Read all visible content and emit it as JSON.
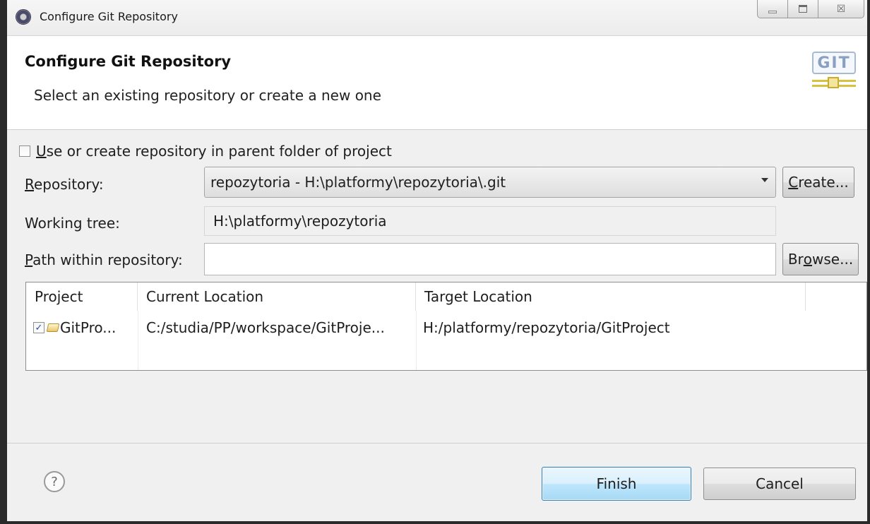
{
  "window": {
    "title": "Configure Git Repository",
    "controls": {
      "minimize_icon": "minimize-icon",
      "maximize_icon": "maximize-icon",
      "close_label": "☒"
    }
  },
  "banner": {
    "title": "Configure Git Repository",
    "subtitle": "Select an existing repository or create a new one",
    "logo_text": "GIT"
  },
  "form": {
    "parent_folder_checkbox": {
      "label_prefix": "U",
      "label_rest": "se or create repository in parent folder of project",
      "checked": false
    },
    "repository": {
      "label_prefix": "R",
      "label_rest": "epository:",
      "value": "repozytoria - H:\\platformy\\repozytoria\\.git"
    },
    "create_button": {
      "prefix": "C",
      "rest": "reate..."
    },
    "working_tree": {
      "label": "Working tree:",
      "value": "H:\\platformy\\repozytoria"
    },
    "path_within_repository": {
      "label_prefix": "P",
      "label_rest": "ath within repository:",
      "value": "",
      "placeholder": ""
    },
    "browse_button": {
      "prefix": "Br",
      "underlined": "o",
      "rest": "wse..."
    }
  },
  "table": {
    "columns": [
      "Project",
      "Current Location",
      "Target Location"
    ],
    "rows": [
      {
        "checked": true,
        "project": "GitPro...",
        "current": "C:/studia/PP/workspace/GitProje...",
        "target": "H:/platformy/repozytoria/GitProject"
      }
    ]
  },
  "footer": {
    "help_label": "?",
    "finish_label": "Finish",
    "cancel_label": "Cancel"
  },
  "colors": {
    "primary_button_border": "#3c7fb1",
    "git_logo_blue": "#8aa0c0",
    "git_logo_gold": "#d9c140"
  }
}
